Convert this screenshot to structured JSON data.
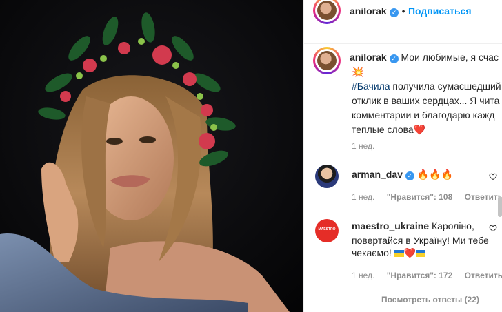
{
  "post": {
    "author": "anilorak",
    "follow_label": "Подписаться",
    "caption_first": "Мои любимые, я счас",
    "caption_hashtag": "#Бачила",
    "caption_rest_1": " получила сумасшедший",
    "caption_line_3": "отклик в ваших сердцах... Я чита",
    "caption_line_4": "комментарии и благодарю кажд",
    "caption_line_5": "теплые слова",
    "caption_time": "1 нед."
  },
  "comments": [
    {
      "user": "arman_dav",
      "text": "",
      "time": "1 нед.",
      "likes": "\"Нравится\": 108",
      "reply": "Ответить"
    },
    {
      "user": "maestro_ukraine",
      "avatar_label": "MAESTRO",
      "text_1": "Кароліно,",
      "text_2": "повертайся в Україну! Ми тебе",
      "text_3": "чекаємо!",
      "time": "1 нед.",
      "likes": "\"Нравится\": 172",
      "reply": "Ответить",
      "view_replies": "Посмотреть ответы (22)"
    }
  ],
  "icons": [
    "verified-badge-icon",
    "heart-outline-icon",
    "fire-emoji",
    "collision-emoji",
    "ukraine-flag-emoji",
    "red-heart-emoji"
  ],
  "colors": {
    "accent": "#0095f6",
    "hashtag": "#00376b",
    "muted": "#8e8e8e",
    "verified": "#3897f0"
  }
}
